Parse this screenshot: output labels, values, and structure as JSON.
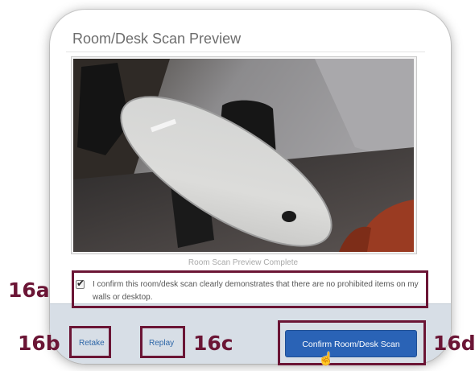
{
  "dialog": {
    "title": "Room/Desk Scan Preview",
    "preview_status": "Room Scan Preview Complete",
    "confirm_checkbox": {
      "checked": true,
      "label": "I confirm this room/desk scan clearly demonstrates that there are no prohibited items on my walls or desktop."
    },
    "buttons": {
      "retake_label": "Retake",
      "replay_label": "Replay",
      "confirm_label": "Confirm Room/Desk Scan"
    }
  },
  "callouts": {
    "a": "16a",
    "b": "16b",
    "c": "16c",
    "d": "16d"
  },
  "colors": {
    "callout": "#6b1535",
    "primary_button": "#2a63b6",
    "link": "#2e67a8",
    "footer_bar": "#d7dee6"
  },
  "icons": {
    "checkbox_mark": "checkmark-icon",
    "cursor": "hand-pointer-cursor-icon"
  }
}
